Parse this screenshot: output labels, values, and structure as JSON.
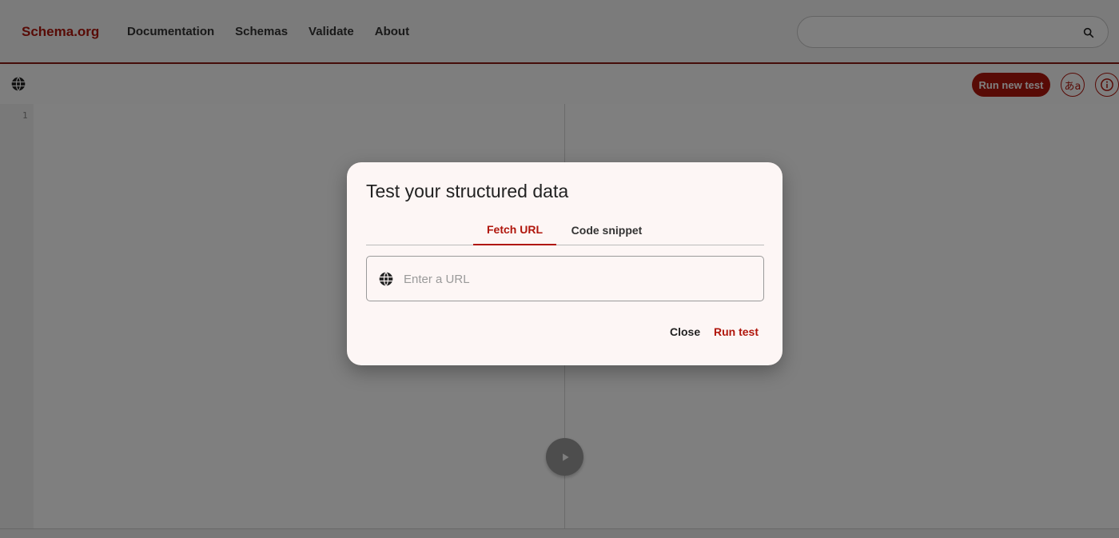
{
  "header": {
    "logo": "Schema.org",
    "nav": [
      "Documentation",
      "Schemas",
      "Validate",
      "About"
    ],
    "search": {
      "value": "",
      "placeholder": "",
      "icon": "search-icon"
    }
  },
  "toolbar": {
    "left_icon": "globe-icon",
    "run_new_test_label": "Run new test",
    "language_label": "あa",
    "info_icon": "info-icon"
  },
  "editor": {
    "line_numbers": [
      "1"
    ],
    "play_icon": "play-icon"
  },
  "dialog": {
    "title": "Test your structured data",
    "tabs": [
      {
        "label": "Fetch URL",
        "active": true
      },
      {
        "label": "Code snippet",
        "active": false
      }
    ],
    "url_input": {
      "value": "",
      "placeholder": "Enter a URL",
      "icon": "globe-icon"
    },
    "close_label": "Close",
    "run_label": "Run test"
  },
  "colors": {
    "accent": "#b0160c",
    "overlay": "rgba(0,0,0,0.5)",
    "dialog_bg": "#fdf6f5"
  }
}
